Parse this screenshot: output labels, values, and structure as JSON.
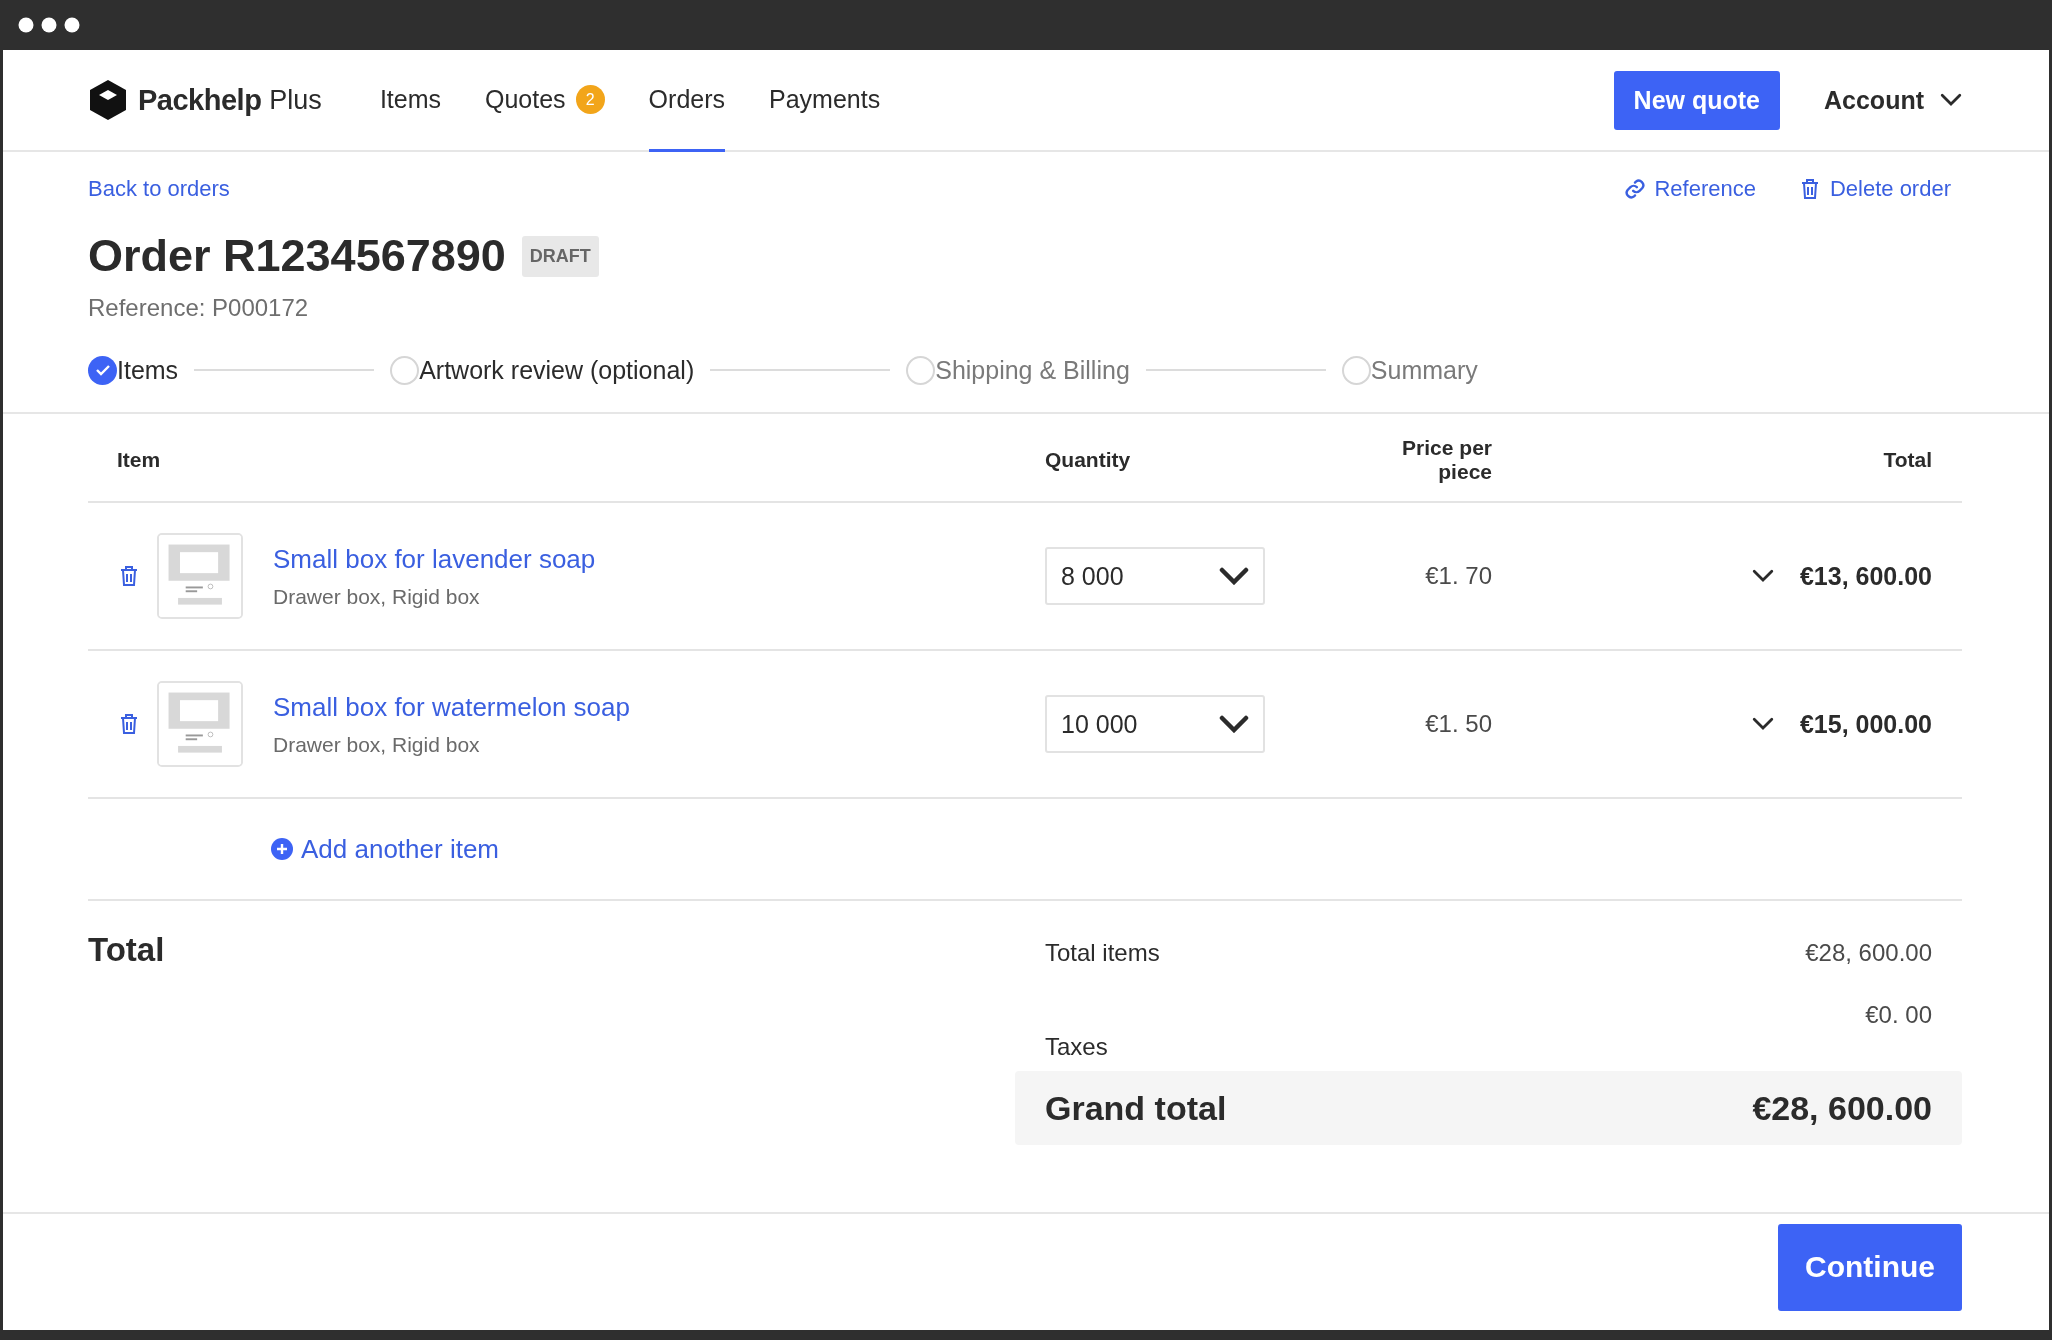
{
  "nav": {
    "brand": "Packhelp",
    "brand_suffix": "Plus",
    "items": [
      {
        "label": "Items",
        "selected": false
      },
      {
        "label": "Quotes",
        "selected": false,
        "badge": "2"
      },
      {
        "label": "Orders",
        "selected": true
      },
      {
        "label": "Payments",
        "selected": false
      }
    ],
    "new_quote": "New quote",
    "account": "Account"
  },
  "back_link": "Back to orders",
  "actions": [
    {
      "kind": "link",
      "label": "Reference"
    },
    {
      "kind": "delete",
      "label": "Delete order"
    }
  ],
  "title": "Order R1234567890",
  "status": "DRAFT",
  "reference": "Reference: P000172",
  "steps": [
    {
      "label": "Items",
      "done": true,
      "enabled": true
    },
    {
      "label": "Artwork review (optional)",
      "done": false,
      "enabled": true
    },
    {
      "label": "Shipping & Billing",
      "done": false,
      "enabled": false
    },
    {
      "label": "Summary",
      "done": false,
      "enabled": false
    }
  ],
  "table": {
    "columns": [
      "Item",
      "Quantity",
      "Price per piece",
      "Total"
    ],
    "rows": [
      {
        "name": "Small box for lavender soap",
        "type": "Drawer box, Rigid box",
        "quantity": "8 000",
        "price": "€1. 70",
        "total": "€13, 600.00"
      },
      {
        "name": "Small box for watermelon soap",
        "type": "Drawer box, Rigid box",
        "quantity": "10 000",
        "price": "€1. 50",
        "total": "€15, 000.00"
      }
    ]
  },
  "add_item": "Add another item",
  "totals": {
    "title": "Total",
    "lines": [
      {
        "label": "Total items",
        "value": "€28, 600.00"
      },
      {
        "label": "Taxes",
        "value": "€0. 00"
      }
    ],
    "grand": {
      "label": "Grand total",
      "value": "€28, 600.00"
    }
  },
  "continue": "Continue"
}
